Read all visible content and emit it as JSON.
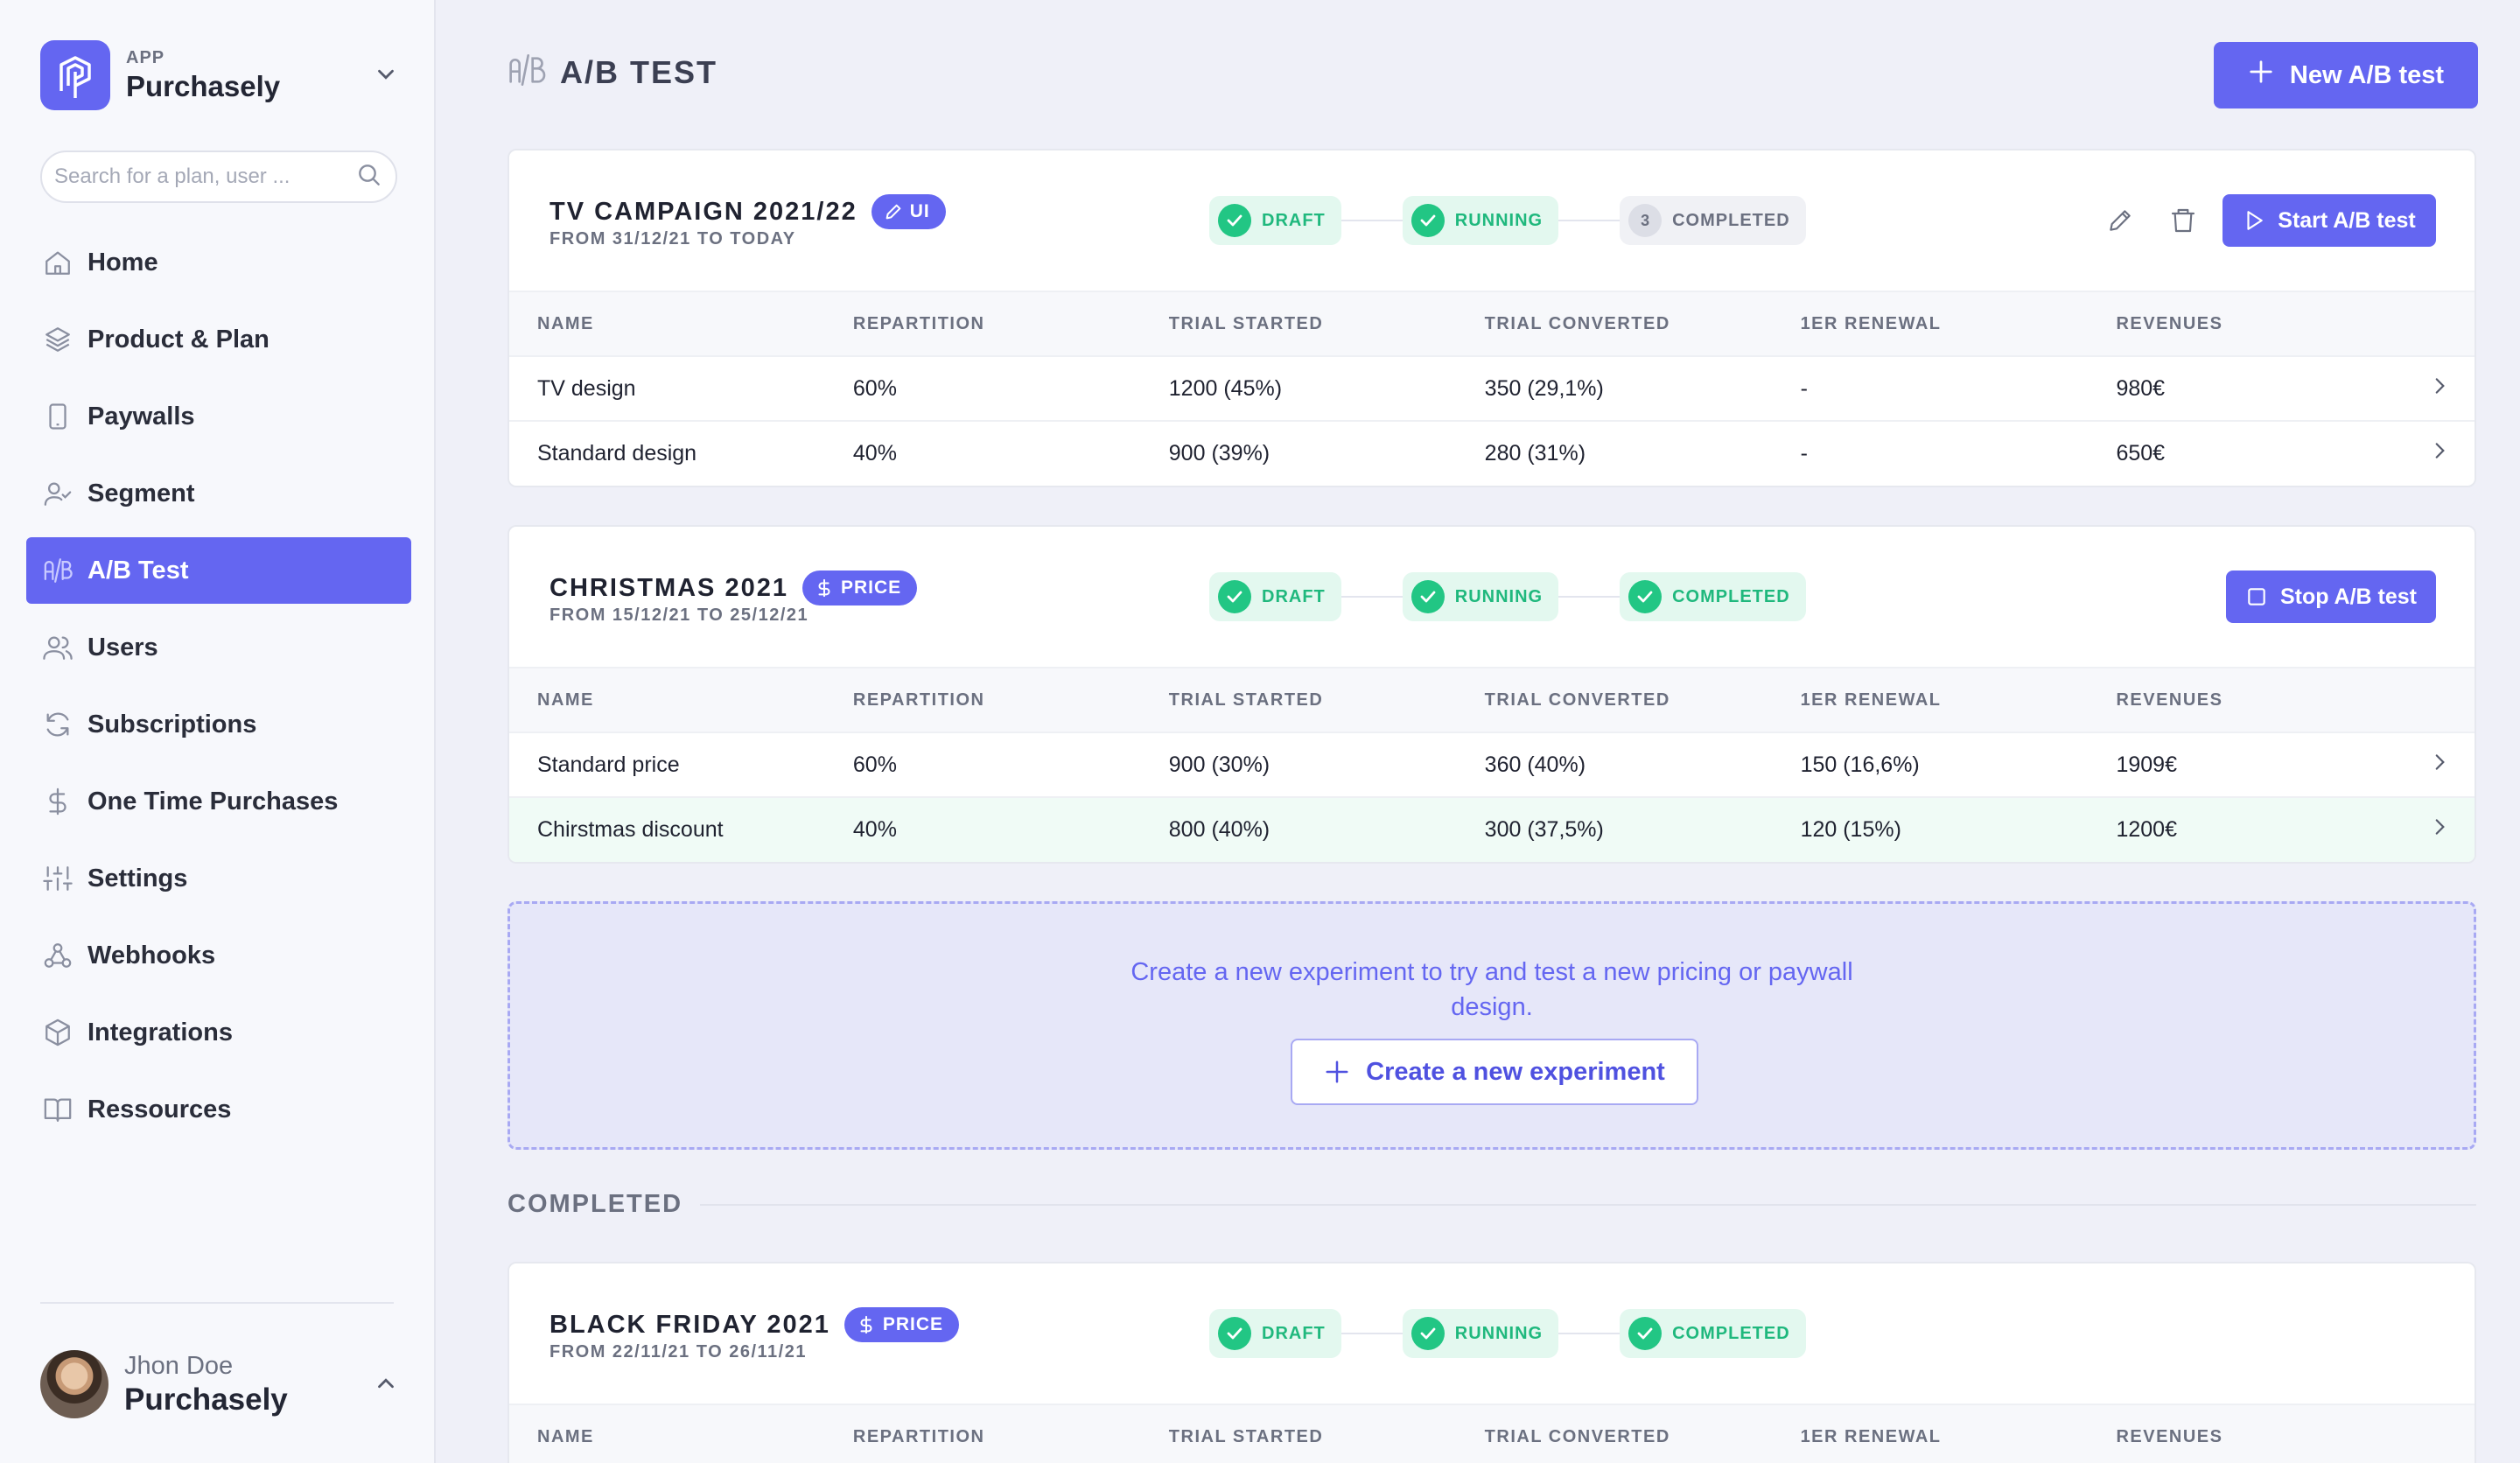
{
  "app": {
    "eyebrow": "APP",
    "name": "Purchasely"
  },
  "search": {
    "placeholder": "Search for a plan, user ..."
  },
  "nav": [
    {
      "label": "Home",
      "icon": "home-icon"
    },
    {
      "label": "Product & Plan",
      "icon": "layers-icon"
    },
    {
      "label": "Paywalls",
      "icon": "phone-icon"
    },
    {
      "label": "Segment",
      "icon": "user-check-icon"
    },
    {
      "label": "A/B Test",
      "icon": "ab-test-icon",
      "active": true
    },
    {
      "label": "Users",
      "icon": "users-icon"
    },
    {
      "label": "Subscriptions",
      "icon": "refresh-icon"
    },
    {
      "label": "One Time Purchases",
      "icon": "dollar-icon"
    },
    {
      "label": "Settings",
      "icon": "sliders-icon"
    },
    {
      "label": "Webhooks",
      "icon": "webhook-icon"
    },
    {
      "label": "Integrations",
      "icon": "box-icon"
    },
    {
      "label": "Ressources",
      "icon": "book-icon"
    }
  ],
  "user": {
    "name": "Jhon Doe",
    "org": "Purchasely"
  },
  "header": {
    "title": "A/B TEST",
    "new_button": "New A/B test"
  },
  "table_headers": [
    "NAME",
    "REPARTITION",
    "TRIAL STARTED",
    "TRIAL CONVERTED",
    "1ER RENEWAL",
    "REVENUES"
  ],
  "steps": {
    "draft": "DRAFT",
    "running": "RUNNING",
    "completed": "COMPLETED",
    "pending_number": "3"
  },
  "experiments": [
    {
      "name": "TV CAMPAIGN 2021/22",
      "tag": "UI",
      "dates": "FROM 31/12/21 TO TODAY",
      "action": "Start A/B test",
      "rows": [
        {
          "name": "TV design",
          "repartition": "60%",
          "trial_started": "1200 (45%)",
          "trial_converted": "350 (29,1%)",
          "renewal": "-",
          "revenues": "980€"
        },
        {
          "name": "Standard design",
          "repartition": "40%",
          "trial_started": "900 (39%)",
          "trial_converted": "280 (31%)",
          "renewal": "-",
          "revenues": "650€"
        }
      ]
    },
    {
      "name": "CHRISTMAS 2021",
      "tag": "PRICE",
      "dates": "FROM 15/12/21 TO 25/12/21",
      "action": "Stop A/B test",
      "rows": [
        {
          "name": "Standard price",
          "repartition": "60%",
          "trial_started": "900 (30%)",
          "trial_converted": "360 (40%)",
          "renewal": "150 (16,6%)",
          "revenues": "1909€"
        },
        {
          "name": "Chirstmas discount",
          "repartition": "40%",
          "trial_started": "800 (40%)",
          "trial_converted": "300 (37,5%)",
          "renewal": "120 (15%)",
          "revenues": "1200€"
        }
      ]
    },
    {
      "name": "BLACK FRIDAY 2021",
      "tag": "PRICE",
      "dates": "FROM 22/11/21 TO 26/11/21"
    }
  ],
  "empty_state": {
    "text": "Create a new experiment to try and test a new pricing or paywall design.",
    "button": "Create a new experiment"
  },
  "completed_section": {
    "label": "COMPLETED"
  },
  "colors": {
    "accent": "#6466f1",
    "success": "#22c684",
    "background": "#eff0f8"
  }
}
